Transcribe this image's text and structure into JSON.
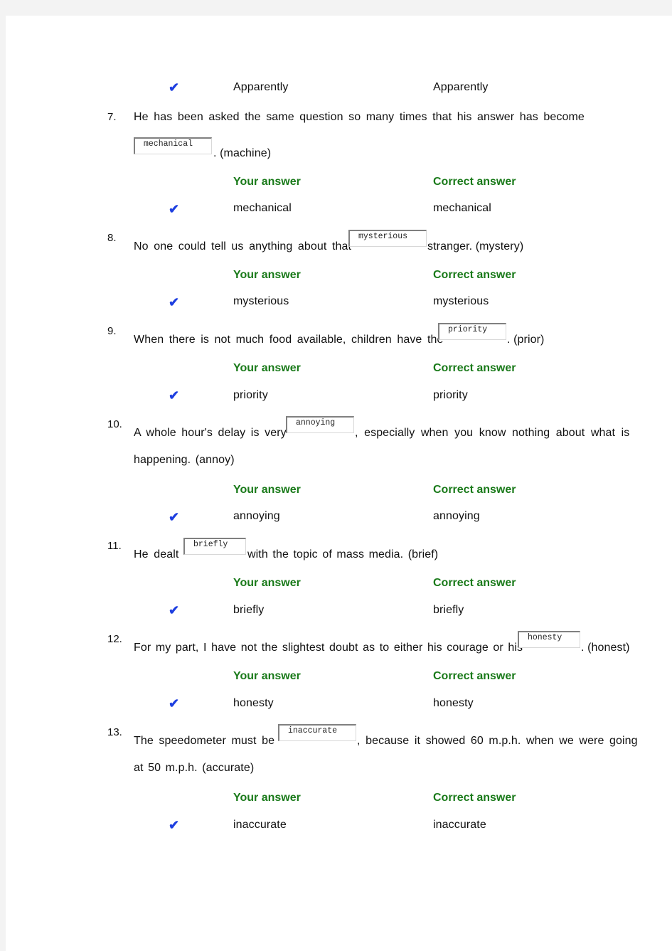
{
  "top_row": {
    "your_answer": "Apparently",
    "correct_answer": "Apparently"
  },
  "labels": {
    "your_answer": "Your answer",
    "correct_answer": "Correct answer"
  },
  "questions": [
    {
      "number": "7.",
      "before": "He has been asked the same question so many times that his answer has become",
      "answer": "mechanical",
      "after": ". (machine)",
      "your_answer": "mechanical",
      "correct_answer": "mechanical"
    },
    {
      "number": "8.",
      "before": "No one could tell us anything about that",
      "answer": "mysterious",
      "after": "stranger. (mystery)",
      "your_answer": "mysterious",
      "correct_answer": "mysterious"
    },
    {
      "number": "9.",
      "before": "When there is not much food available, children have the",
      "answer": "priority",
      "after": ". (prior)",
      "your_answer": "priority",
      "correct_answer": "priority"
    },
    {
      "number": "10.",
      "before": "A whole hour's delay is very",
      "answer": "annoying",
      "after": ", especially when you know nothing about what is",
      "line2": "happening. (annoy)",
      "your_answer": "annoying",
      "correct_answer": "annoying"
    },
    {
      "number": "11.",
      "before": "He dealt",
      "answer": "briefly",
      "after": "with the topic of mass media. (brief)",
      "your_answer": "briefly",
      "correct_answer": "briefly"
    },
    {
      "number": "12.",
      "before": "For my part, I have not the slightest doubt as to either his courage or his",
      "answer": "honesty",
      "after": ". (honest)",
      "your_answer": "honesty",
      "correct_answer": "honesty"
    },
    {
      "number": "13.",
      "before": "The speedometer must be",
      "answer": "inaccurate",
      "after": ", because it showed 60 m.p.h. when we were going",
      "line2": "at 50 m.p.h. (accurate)",
      "your_answer": "inaccurate",
      "correct_answer": "inaccurate"
    }
  ],
  "icons": {
    "check": "✔"
  },
  "colors": {
    "header_green": "#1a7a1a",
    "check_blue": "#1e3fe0"
  }
}
